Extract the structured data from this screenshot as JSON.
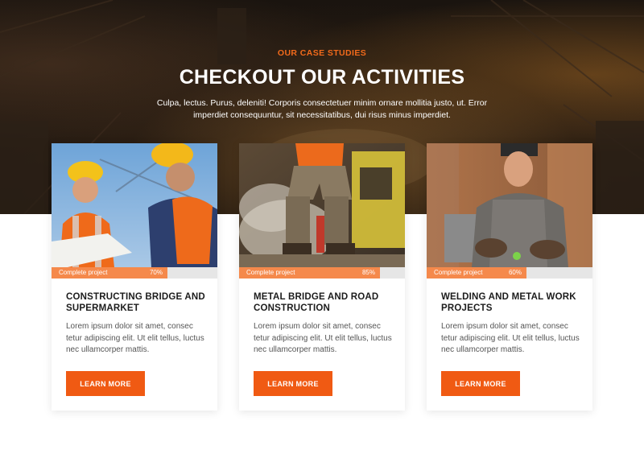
{
  "section": {
    "eyebrow": "OUR CASE STUDIES",
    "headline": "CHECKOUT OUR ACTIVITIES",
    "intro": "Culpa, lectus. Purus, deleniti! Corporis consectetuer minim ornare mollitia justo, ut. Error imperdiet consequuntur, sit necessitatibus, dui risus minus imperdiet."
  },
  "colors": {
    "accent": "#f05a13",
    "eyebrow": "#f26a1b",
    "progress_fill": "#f5894b",
    "progress_track": "#e6e6e6",
    "hero_dark": "#1a140f"
  },
  "cards": [
    {
      "title": "CONSTRUCTING BRIDGE AND SUPERMARKET",
      "progress_label": "Complete project",
      "progress_text": "70%",
      "progress": 0.7,
      "description": "Lorem ipsum dolor sit amet, consec tetur adipiscing elit. Ut elit tellus, luctus nec ullamcorper mattis.",
      "button_label": "LEARN MORE",
      "image": "engineers-reviewing-plans-photo"
    },
    {
      "title": "METAL BRIDGE AND ROAD CONSTRUCTION",
      "progress_label": "Complete project",
      "progress_text": "85%",
      "progress": 0.85,
      "description": "Lorem ipsum dolor sit amet, consec tetur adipiscing elit. Ut elit tellus, luctus nec ullamcorper mattis.",
      "button_label": "LEARN MORE",
      "image": "worker-with-jackhammer-photo"
    },
    {
      "title": "WELDING AND METAL WORK PROJECTS",
      "progress_label": "Complete project",
      "progress_text": "60%",
      "progress": 0.6,
      "description": "Lorem ipsum dolor sit amet, consec tetur adipiscing elit. Ut elit tellus, luctus nec ullamcorper mattis.",
      "button_label": "LEARN MORE",
      "image": "welder-at-work-photo"
    }
  ]
}
